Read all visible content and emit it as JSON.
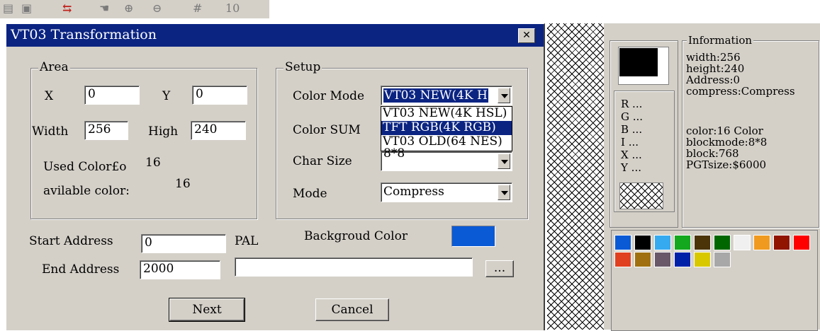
{
  "toolbar": {
    "grid_glyph": "#",
    "zoom_text": "10"
  },
  "dialog": {
    "title": "VT03 Transformation",
    "close_label": "✕",
    "area": {
      "legend": "Area",
      "x_label": "X",
      "x_value": "0",
      "y_label": "Y",
      "y_value": "0",
      "width_label": "Width",
      "width_value": "256",
      "high_label": "High",
      "high_value": "240",
      "used_color_label": "Used Color£o",
      "used_color_value": "16",
      "available_label": "avilable color:",
      "available_value": "16"
    },
    "setup": {
      "legend": "Setup",
      "color_mode_label": "Color Mode",
      "color_mode_value": "VT03 NEW(4K H",
      "color_mode_options": [
        "VT03 NEW(4K HSL)",
        "TFT RGB(4K RGB)",
        "VT03 OLD(64 NES)"
      ],
      "color_sum_label": "Color SUM",
      "char_size_label": "Char Size",
      "char_size_value": "8*8",
      "mode_label": "Mode",
      "mode_value": "Compress"
    },
    "start_address_label": "Start Address",
    "start_address_value": "0",
    "end_address_label": "End Address",
    "end_address_value": "2000",
    "pal_label": "PAL",
    "pal_path_value": "",
    "browse_label": "...",
    "background_color_label": "Backgroud Color",
    "background_color": "#0a5ad6",
    "next_label": "Next",
    "cancel_label": "Cancel"
  },
  "side_panel": {
    "rgb_lines": [
      "R ...",
      "G ...",
      "B ...",
      "I ...",
      "X ...",
      "Y ..."
    ],
    "info_legend": "Information",
    "info_lines_top": [
      "width:256",
      "height:240",
      "Address:0",
      "compress:Compress"
    ],
    "info_lines_bottom": [
      "color:16 Color",
      "blockmode:8*8",
      "block:768",
      "PGTsize:$6000"
    ]
  },
  "palette_colors": [
    "#0a5ad6",
    "#000000",
    "#36aaf0",
    "#14a81e",
    "#4a3408",
    "#006600",
    "#f0f0f0",
    "#f09a20",
    "#901400",
    "#ff0000",
    "#e04020",
    "#a07010",
    "#685868",
    "#0020a8",
    "#d8c800",
    "#a8a8a8"
  ]
}
